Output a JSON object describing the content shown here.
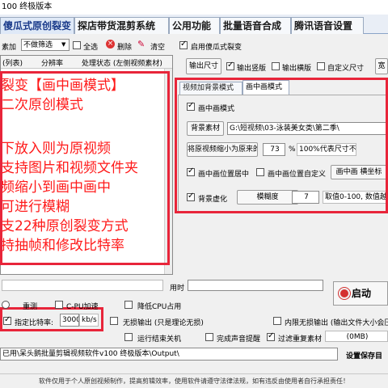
{
  "window": {
    "title": "100 终极版本"
  },
  "tabs": [
    {
      "label": "傻瓜式原创裂变",
      "active": true
    },
    {
      "label": "探店带货混剪系统",
      "active": false
    },
    {
      "label": "公用功能",
      "active": false
    },
    {
      "label": "批量语音合成",
      "active": false
    },
    {
      "label": "腾讯语音设置",
      "active": false
    }
  ],
  "toolbar": {
    "add_label": "素加",
    "filter_value": "不做筛选",
    "select_all_label": "全选",
    "delete_label": "删除",
    "clear_label": "清空",
    "enable_label": "启用傻瓜式裂变"
  },
  "list": {
    "columns": [
      "(列表)",
      "分辨率",
      "处理状态 (左侧视频素材)"
    ]
  },
  "overlay_text": [
    "裂变【画中画模式】",
    "二次原创模式",
    "下放入则为原视频",
    "支持图片和视频文件夹",
    "频缩小到画中画中",
    "可进行模糊",
    "支22种原创裂变方式",
    "持抽帧和修改比特率"
  ],
  "output_opts": {
    "output_size_btn": "输出尺寸",
    "portrait_label": "输出竖版",
    "landscape_label": "输出横版",
    "custom_label": "自定义尺寸",
    "width_btn": "宽"
  },
  "subtabs": [
    {
      "label": "视频加背景模式",
      "active": false
    },
    {
      "label": "画中画模式",
      "active": true
    }
  ],
  "pip": {
    "enable_label": "画中画模式",
    "bg_btn": "背景素材",
    "bg_path": "G:\\短视频\\03-泳装美女类\\第二季\\",
    "scale_btn": "将原视频缩小为原来的",
    "scale_value": "73",
    "scale_unit": "%",
    "scale_note": "100%代表尺寸不变",
    "center_label": "画中画位置居中",
    "custom_pos_label": "画中画位置自定义",
    "coord_btn": "画中画  横坐标",
    "blur_label": "背景虚化",
    "blur_btn": "模糊度",
    "blur_value": "7",
    "blur_hint": "取值0-100, 数值越"
  },
  "bottom": {
    "time_label": "用时",
    "start_label": "启动",
    "detect_label": "重测",
    "cpu_label": "C-PU加速",
    "lower_cpu_label": "降低CPU占用",
    "bitrate_label": "指定比特率:",
    "bitrate_value": "3000",
    "bitrate_unit": "kb/s",
    "lossless_label": "无损输出 (只是理论无损)",
    "lossless_compress_label": "内限无损输出 (输出文件大小会压缩",
    "shutdown_label": "运行结束关机",
    "sound_label": "完成声音提醒",
    "skip_label": "过滤重复素材",
    "mb_label": "(0MB)",
    "out_path": "已用\\呆头鹅批量剪辑视频软件v100 终极版本\\Output\\",
    "set_path_label": "设置保存目"
  },
  "footer_text": "软件仅用于个人原创视频制作，提高剪辑效率，使用软件请遵守法律法规，如有违反由使用者自行承担责任！"
}
